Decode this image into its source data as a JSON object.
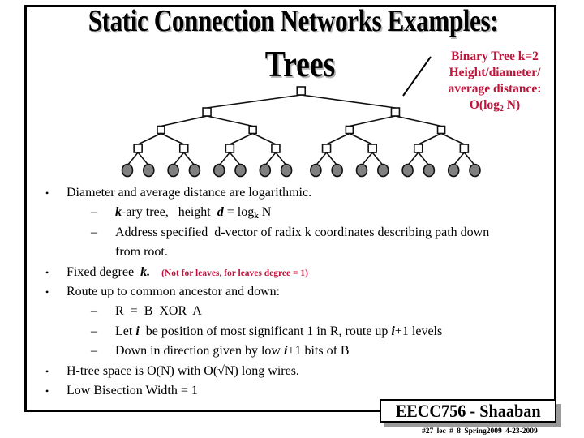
{
  "slide": {
    "title": "Static Connection Networks Examples:",
    "subtitle": "Trees",
    "accent_color": "#c0143c"
  },
  "callout": {
    "line1": "Binary Tree  k=2",
    "line2": "Height/diameter/",
    "line3": "average distance:",
    "line4_prefix": "O(log",
    "line4_sub": "2",
    "line4_suffix": " N)"
  },
  "diagram": {
    "type": "binary-tree",
    "levels": 5,
    "internal_node_shape": "square",
    "leaf_shape": "filled-circle",
    "leaf_count": 16,
    "leaf_color": "#808080"
  },
  "bullets": [
    {
      "level": 1,
      "marker": "•",
      "text": "Diameter and average distance are logarithmic."
    },
    {
      "level": 2,
      "marker": "–",
      "parts": {
        "k": "k",
        "a": "-ary tree,   height  ",
        "d": "d",
        "b": " = log",
        "sub": "k",
        "c": " N"
      }
    },
    {
      "level": 2,
      "marker": "–",
      "text": "Address specified  d-vector of radix k coordinates describing path down",
      "continuation": "from root."
    },
    {
      "level": 1,
      "marker": "•",
      "parts": {
        "a": "Fixed degree  ",
        "k": "k.",
        "note": "(Not for leaves, for leaves degree = 1)"
      }
    },
    {
      "level": 1,
      "marker": "•",
      "text": "Route up to common ancestor and down:"
    },
    {
      "level": 2,
      "marker": "–",
      "text": "R  =  B  XOR  A"
    },
    {
      "level": 2,
      "marker": "–",
      "parts": {
        "a": "Let ",
        "i1": "i",
        "b": "  be position of most significant 1 in R, route up ",
        "i2": "i",
        "c": "+1 levels"
      }
    },
    {
      "level": 2,
      "marker": "–",
      "parts": {
        "a": "Down in direction given by low ",
        "i": "i",
        "b": "+1 bits of B"
      }
    },
    {
      "level": 1,
      "marker": "•",
      "text": "H-tree space is O(N) with O(√N) long wires."
    },
    {
      "level": 1,
      "marker": "•",
      "text": "Low Bisection Width = 1"
    }
  ],
  "footer": {
    "label": "EECC756 - Shaaban",
    "meta": "#27  lec # 8    Spring2009  4-23-2009"
  }
}
